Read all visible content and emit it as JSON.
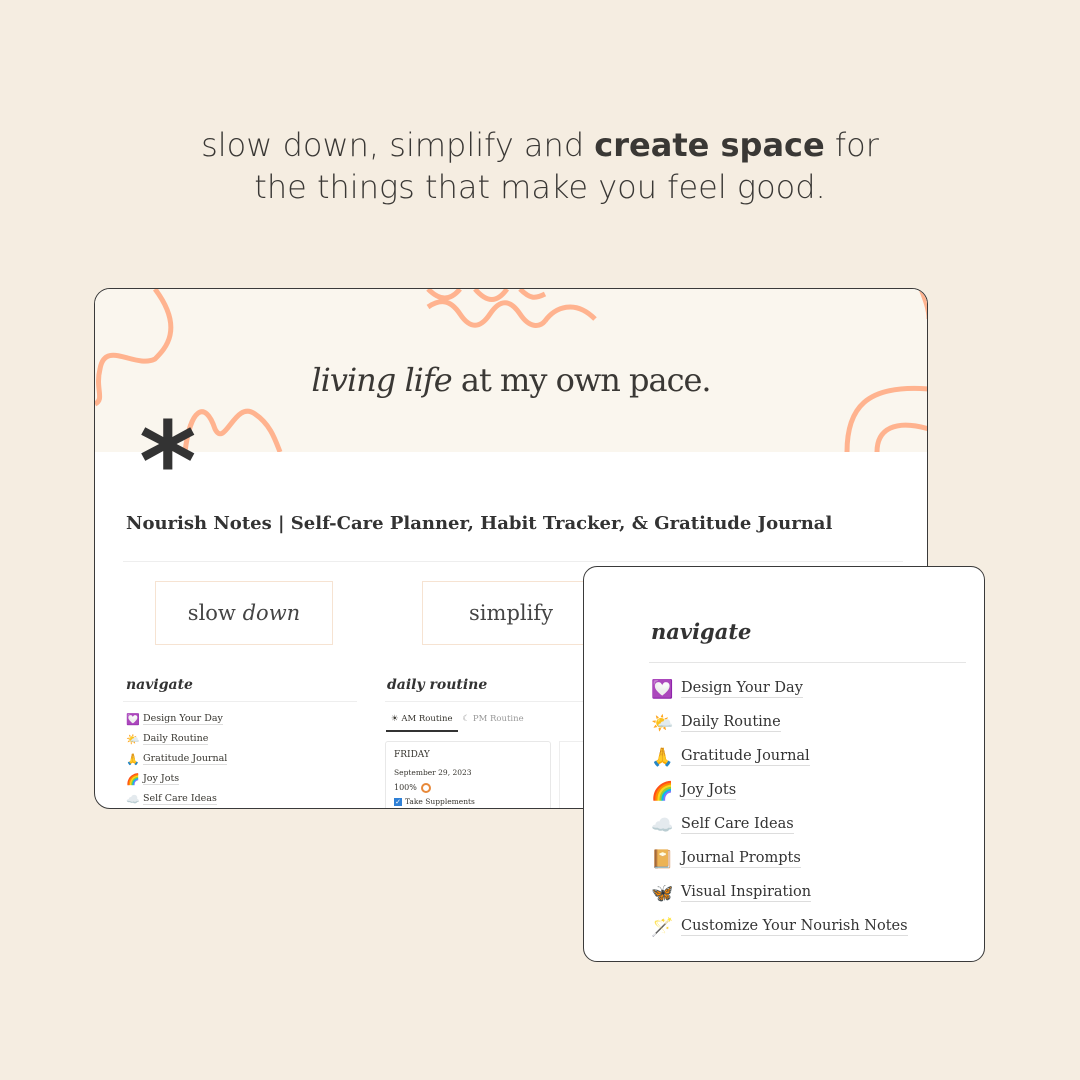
{
  "tagline": {
    "pre": "slow down, simplify and ",
    "bold": "create space",
    "post": " for",
    "line2": "the things that make you feel good."
  },
  "banner": {
    "quote_italic": "living life",
    "quote_rest": " at my own pace.",
    "accent": "#ffb38f"
  },
  "page": {
    "title": "Nourish Notes | Self-Care Planner, Habit Tracker, & Gratitude Journal",
    "pill1": {
      "plain": "slow ",
      "italic": "down"
    },
    "pill2": "simplify"
  },
  "navigate": {
    "heading": "navigate",
    "items": [
      {
        "icon": "💟",
        "label": "Design Your Day"
      },
      {
        "icon": "🌤️",
        "label": "Daily Routine"
      },
      {
        "icon": "🙏",
        "label": "Gratitude Journal"
      },
      {
        "icon": "🌈",
        "label": "Joy Jots"
      },
      {
        "icon": "☁️",
        "label": "Self Care Ideas"
      },
      {
        "icon": "📔",
        "label": "Journal Prompts"
      },
      {
        "icon": "🦋",
        "label": "Visual Inspiration"
      },
      {
        "icon": "🪄",
        "label": "Customize Your Nourish Notes"
      }
    ]
  },
  "routine": {
    "heading": "daily routine",
    "tabs": [
      {
        "icon": "☀",
        "label": "AM Routine"
      },
      {
        "icon": "☾",
        "label": "PM Routine"
      }
    ],
    "card": {
      "day": "FRIDAY",
      "date": "September 29, 2023",
      "progress": "100%",
      "task": "Take Supplements",
      "task_checked": true
    }
  }
}
